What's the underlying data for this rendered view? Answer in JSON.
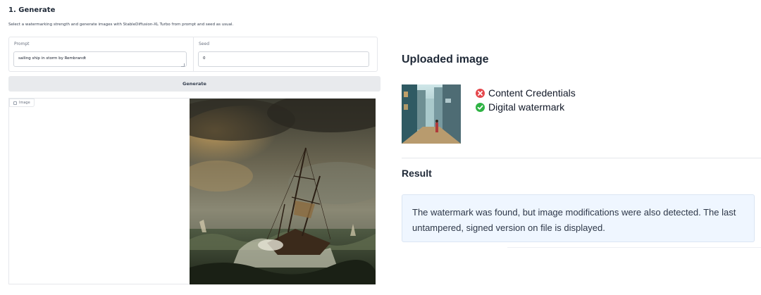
{
  "generate": {
    "title": "1. Generate",
    "description": "Select a watermarking strength and generate images with StableDiffusion-XL Turbo from prompt and seed as usual.",
    "prompt": {
      "label": "Prompt",
      "value": "sailing ship in storm by Rembrandt"
    },
    "seed": {
      "label": "Seed",
      "value": "0"
    },
    "generate_button": "Generate",
    "image_tag": "Image",
    "image_icon": "image-icon"
  },
  "verify": {
    "uploaded_title": "Uploaded image",
    "checks": [
      {
        "label": "Content Credentials",
        "status": "fail",
        "icon": "x-circle-icon",
        "color": "#e5484d"
      },
      {
        "label": "Digital watermark",
        "status": "pass",
        "icon": "check-circle-icon",
        "color": "#2fb344"
      }
    ],
    "result_title": "Result",
    "result_message": "The watermark was found, but image modifications were also detected. The last untampered, signed version on file is displayed."
  },
  "colors": {
    "button_bg": "#e8eaed",
    "result_bg": "#eff6ff"
  }
}
